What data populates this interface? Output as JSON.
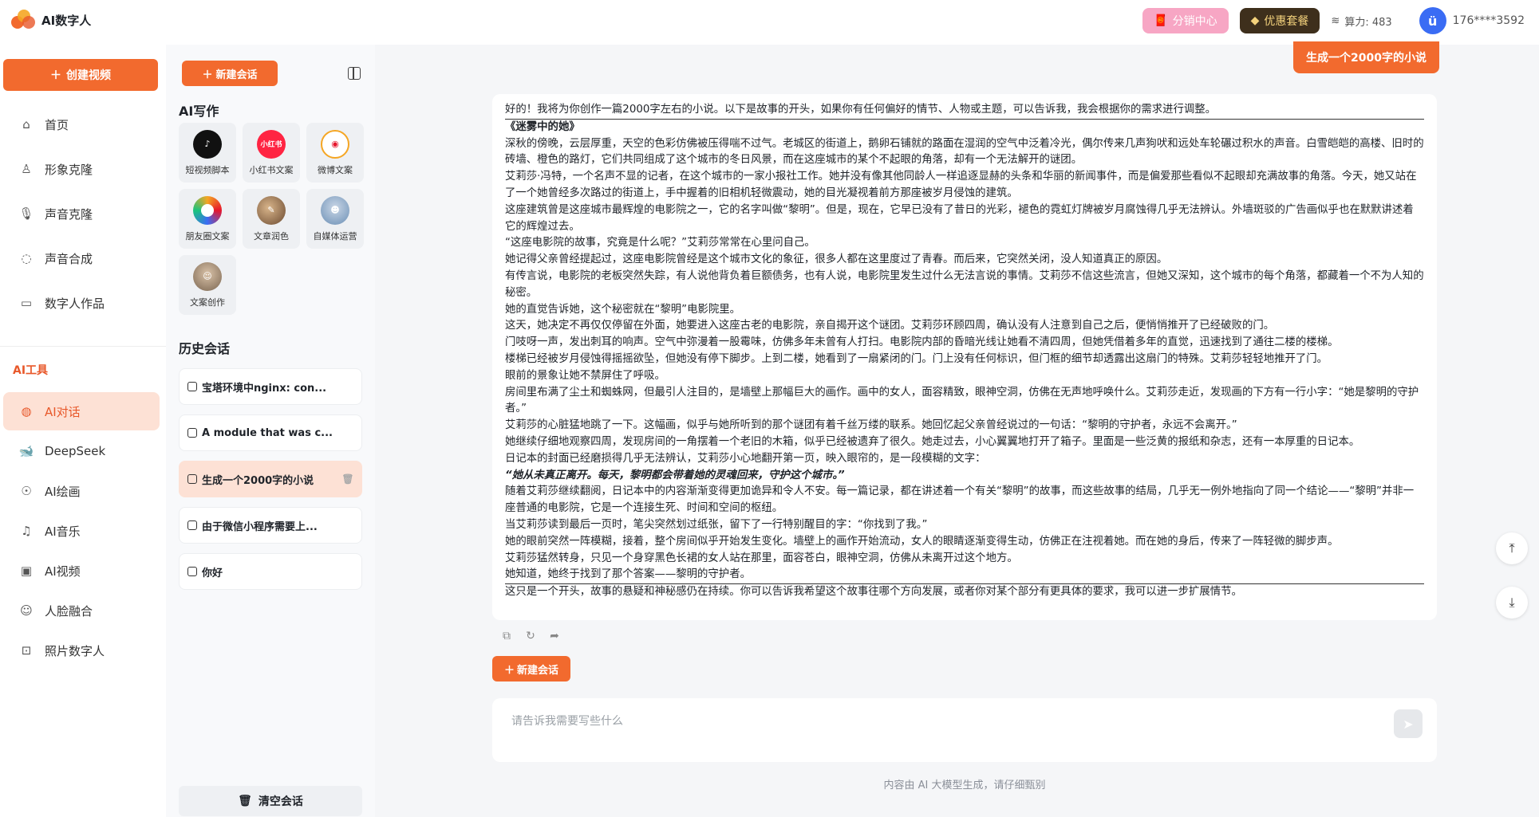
{
  "brand": {
    "name": "AI数字人"
  },
  "topbar": {
    "distribution_label": "分销中心",
    "vip_label": "优惠套餐",
    "power_label": "算力: 483",
    "user_name": "176****3592"
  },
  "sidebar": {
    "create_label": "创建视频",
    "main_items": [
      {
        "label": "首页",
        "icon": "home-icon"
      },
      {
        "label": "形象克隆",
        "icon": "user-icon"
      },
      {
        "label": "声音克隆",
        "icon": "microphone-icon"
      },
      {
        "label": "声音合成",
        "icon": "speech-bubble-icon"
      },
      {
        "label": "数字人作品",
        "icon": "video-icon"
      }
    ],
    "section_label": "AI工具",
    "tool_items": [
      {
        "label": "AI对话",
        "icon": "chat-icon",
        "active": true
      },
      {
        "label": "DeepSeek",
        "icon": "whale-icon"
      },
      {
        "label": "AI绘画",
        "icon": "palette-icon"
      },
      {
        "label": "AI音乐",
        "icon": "music-icon"
      },
      {
        "label": "AI视频",
        "icon": "film-icon"
      },
      {
        "label": "人脸融合",
        "icon": "face-icon"
      },
      {
        "label": "照片数字人",
        "icon": "photo-person-icon"
      }
    ]
  },
  "panel": {
    "new_chat_label": "新建会话",
    "ai_writing_title": "AI写作",
    "tools": [
      {
        "label": "短视频脚本",
        "icon": "tiktok-icon",
        "color": "#111111",
        "glyph": "♪"
      },
      {
        "label": "小红书文案",
        "icon": "xiaohongshu-icon",
        "color": "#ff2442",
        "glyph": "小红书"
      },
      {
        "label": "微博文案",
        "icon": "weibo-icon",
        "color": "#f5a623",
        "glyph": "◉"
      },
      {
        "label": "朋友圈文案",
        "icon": "moments-icon",
        "color": "#ffffff",
        "glyph": "◎"
      },
      {
        "label": "文章润色",
        "icon": "article-icon",
        "color": "#8b5a3c",
        "glyph": "✎"
      },
      {
        "label": "自媒体运营",
        "icon": "media-icon",
        "color": "#6b8fb5",
        "glyph": "☻"
      },
      {
        "label": "文案创作",
        "icon": "copywriting-icon",
        "color": "#7a6550",
        "glyph": "☺"
      }
    ],
    "history_title": "历史会话",
    "history": [
      {
        "label": "宝塔环境中nginx: con..."
      },
      {
        "label": "A module that was c..."
      },
      {
        "label": "生成一个2000字的小说",
        "active": true
      },
      {
        "label": "由于微信小程序需要上..."
      },
      {
        "label": "你好"
      }
    ],
    "clear_label": "清空会话"
  },
  "chat": {
    "user_message": "生成一个2000字的小说",
    "ai_intro": "好的！我将为你创作一篇2000字左右的小说。以下是故事的开头，如果你有任何偏好的情节、人物或主题，可以告诉我，我会根据你的需求进行调整。",
    "story_title": "《迷雾中的她》",
    "paragraphs": [
      "深秋的傍晚，云层厚重，天空的色彩仿佛被压得喘不过气。老城区的街道上，鹅卵石铺就的路面在湿润的空气中泛着冷光，偶尔传来几声狗吠和远处车轮碾过积水的声音。白雪皑皑的高楼、旧时的砖墙、橙色的路灯，它们共同组成了这个城市的冬日风景，而在这座城市的某个不起眼的角落，却有一个无法解开的谜团。",
      "艾莉莎·冯特，一个名声不显的记者，在这个城市的一家小报社工作。她并没有像其他同龄人一样追逐显赫的头条和华丽的新闻事件，而是偏爱那些看似不起眼却充满故事的角落。今天，她又站在了一个她曾经多次路过的街道上，手中握着的旧相机轻微震动，她的目光凝视着前方那座被岁月侵蚀的建筑。",
      "这座建筑曾是这座城市最辉煌的电影院之一，它的名字叫做“黎明”。但是，现在，它早已没有了昔日的光彩，褪色的霓虹灯牌被岁月腐蚀得几乎无法辨认。外墙斑驳的广告画似乎也在默默讲述着它的辉煌过去。",
      "“这座电影院的故事，究竟是什么呢？”艾莉莎常常在心里问自己。",
      "她记得父亲曾经提起过，这座电影院曾经是这个城市文化的象征，很多人都在这里度过了青春。而后来，它突然关闭，没人知道真正的原因。",
      "有传言说，电影院的老板突然失踪，有人说他背负着巨额债务，也有人说，电影院里发生过什么无法言说的事情。艾莉莎不信这些流言，但她又深知，这个城市的每个角落，都藏着一个不为人知的秘密。",
      "她的直觉告诉她，这个秘密就在“黎明”电影院里。",
      "这天，她决定不再仅仅停留在外面，她要进入这座古老的电影院，亲自揭开这个谜团。艾莉莎环顾四周，确认没有人注意到自己之后，便悄悄推开了已经破败的门。",
      "门吱呀一声，发出刺耳的响声。空气中弥漫着一股霉味，仿佛多年未曾有人打扫。电影院内部的昏暗光线让她看不清四周，但她凭借着多年的直觉，迅速找到了通往二楼的楼梯。",
      "楼梯已经被岁月侵蚀得摇摇欲坠，但她没有停下脚步。上到二楼，她看到了一扇紧闭的门。门上没有任何标识，但门框的细节却透露出这扇门的特殊。艾莉莎轻轻地推开了门。",
      "眼前的景象让她不禁屏住了呼吸。",
      "房间里布满了尘土和蜘蛛网，但最引人注目的，是墙壁上那幅巨大的画作。画中的女人，面容精致，眼神空洞，仿佛在无声地呼唤什么。艾莉莎走近，发现画的下方有一行小字：“她是黎明的守护者。”",
      "艾莉莎的心脏猛地跳了一下。这幅画，似乎与她所听到的那个谜团有着千丝万缕的联系。她回忆起父亲曾经说过的一句话：“黎明的守护者，永远不会离开。”",
      "她继续仔细地观察四周，发现房间的一角摆着一个老旧的木箱，似乎已经被遗弃了很久。她走过去，小心翼翼地打开了箱子。里面是一些泛黄的报纸和杂志，还有一本厚重的日记本。",
      "日记本的封面已经磨损得几乎无法辨认，艾莉莎小心地翻开第一页，映入眼帘的，是一段模糊的文字："
    ],
    "quote": "“她从未真正离开。每天，黎明都会带着她的灵魂回来，守护这个城市。”",
    "paragraphs_2": [
      "随着艾莉莎继续翻阅，日记本中的内容渐渐变得更加诡异和令人不安。每一篇记录，都在讲述着一个有关“黎明”的故事，而这些故事的结局，几乎无一例外地指向了同一个结论——“黎明”并非一座普通的电影院，它是一个连接生死、时间和空间的枢纽。",
      "当艾莉莎读到最后一页时，笔尖突然划过纸张，留下了一行特别醒目的字：“你找到了我。”",
      "她的眼前突然一阵模糊，接着，整个房间似乎开始发生变化。墙壁上的画作开始流动，女人的眼睛逐渐变得生动，仿佛正在注视着她。而在她的身后，传来了一阵轻微的脚步声。",
      "艾莉莎猛然转身，只见一个身穿黑色长裙的女人站在那里，面容苍白，眼神空洞，仿佛从未离开过这个地方。",
      "她知道，她终于找到了那个答案——黎明的守护者。"
    ],
    "ai_outro": "这只是一个开头，故事的悬疑和神秘感仍在持续。你可以告诉我希望这个故事往哪个方向发展，或者你对某个部分有更具体的要求，我可以进一步扩展情节。",
    "new_chat_label": "新建会话",
    "input_placeholder": "请告诉我需要写些什么",
    "footer_note": "内容由 AI 大模型生成，请仔细甄别"
  }
}
